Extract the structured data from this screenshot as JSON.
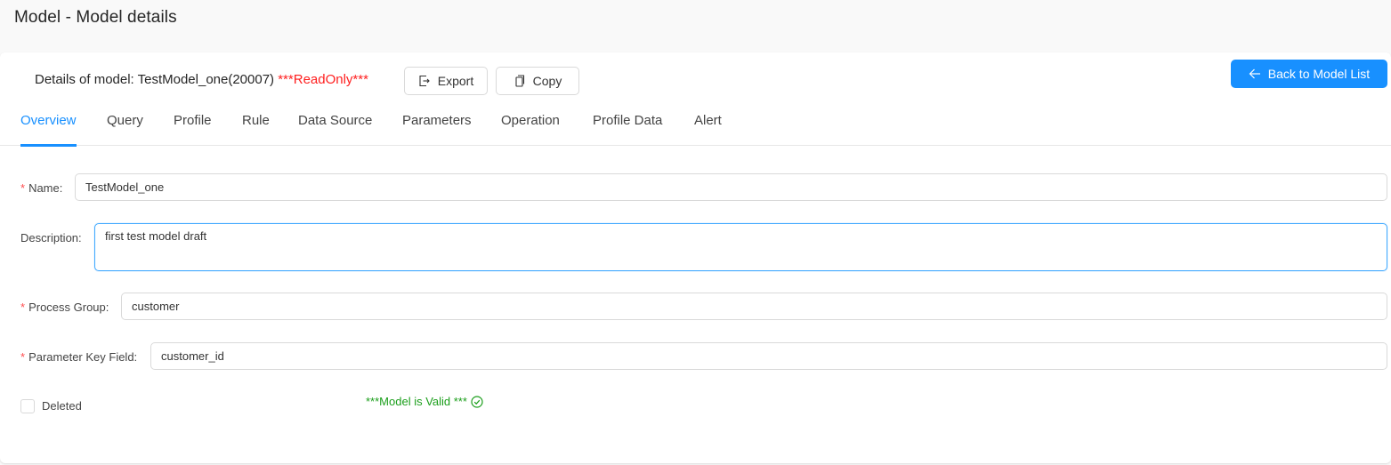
{
  "page": {
    "title": "Model - Model details"
  },
  "details": {
    "prefix": "Details of model: TestModel_one(20007) ",
    "readonly_flag": "***ReadOnly***",
    "export_label": "Export",
    "copy_label": "Copy",
    "back_label": "Back to Model List"
  },
  "tabs": [
    {
      "label": "Overview",
      "active": true
    },
    {
      "label": "Query",
      "active": false
    },
    {
      "label": "Profile",
      "active": false
    },
    {
      "label": "Rule",
      "active": false
    },
    {
      "label": "Data Source",
      "active": false
    },
    {
      "label": "Parameters",
      "active": false
    },
    {
      "label": "Operation",
      "active": false
    },
    {
      "label": "Profile Data",
      "active": false
    },
    {
      "label": "Alert",
      "active": false
    }
  ],
  "form": {
    "required_mark": "*",
    "name": {
      "label": "Name:",
      "value": "TestModel_one"
    },
    "description": {
      "label": "Description:",
      "value": "first test model draft"
    },
    "process_group": {
      "label": "Process Group:",
      "value": "customer"
    },
    "parameter_key_field": {
      "label": "Parameter Key Field:",
      "value": "customer_id"
    },
    "deleted": {
      "label": "Deleted",
      "checked": false
    },
    "valid_message": "***Model is Valid *** "
  },
  "colors": {
    "accent": "#1890ff",
    "readonly": "#ff1f1f",
    "valid": "#1b9e1b",
    "required": "#ff4d4f"
  }
}
